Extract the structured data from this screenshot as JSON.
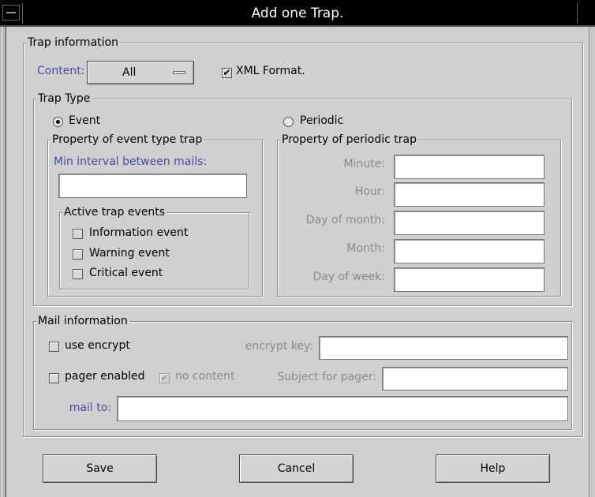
{
  "window": {
    "title": "Add one Trap."
  },
  "trap_info": {
    "legend": "Trap information",
    "content_label": "Content:",
    "content_value": "All",
    "xml_format_label": "XML Format.",
    "xml_format_checked": true
  },
  "trap_type": {
    "legend": "Trap Type",
    "event_label": "Event",
    "event_selected": true,
    "periodic_label": "Periodic",
    "periodic_selected": false
  },
  "event_prop": {
    "legend": "Property of event type trap",
    "min_interval_label": "Min interval between mails:",
    "min_interval_value": "",
    "active_legend": "Active trap events",
    "events": [
      {
        "label": "Information event",
        "checked": false
      },
      {
        "label": "Warning event",
        "checked": false
      },
      {
        "label": "Critical event",
        "checked": false
      }
    ]
  },
  "periodic_prop": {
    "legend": "Property of periodic trap",
    "fields": [
      {
        "label": "Minute:",
        "value": ""
      },
      {
        "label": "Hour:",
        "value": ""
      },
      {
        "label": "Day of month:",
        "value": ""
      },
      {
        "label": "Month:",
        "value": ""
      },
      {
        "label": "Day of week:",
        "value": ""
      }
    ]
  },
  "mail": {
    "legend": "Mail information",
    "use_encrypt_label": "use encrypt",
    "encrypt_key_label": "encrypt key:",
    "encrypt_key_value": "",
    "pager_enabled_label": "pager enabled",
    "no_content_label": "no content",
    "no_content_checked": true,
    "subject_label": "Subject for pager:",
    "subject_value": "",
    "mail_to_label": "mail to:",
    "mail_to_value": ""
  },
  "buttons": {
    "save": "Save",
    "cancel": "Cancel",
    "help": "Help"
  },
  "icons": {
    "window_menu": "window-menu-icon",
    "check": "checkmark-icon"
  }
}
